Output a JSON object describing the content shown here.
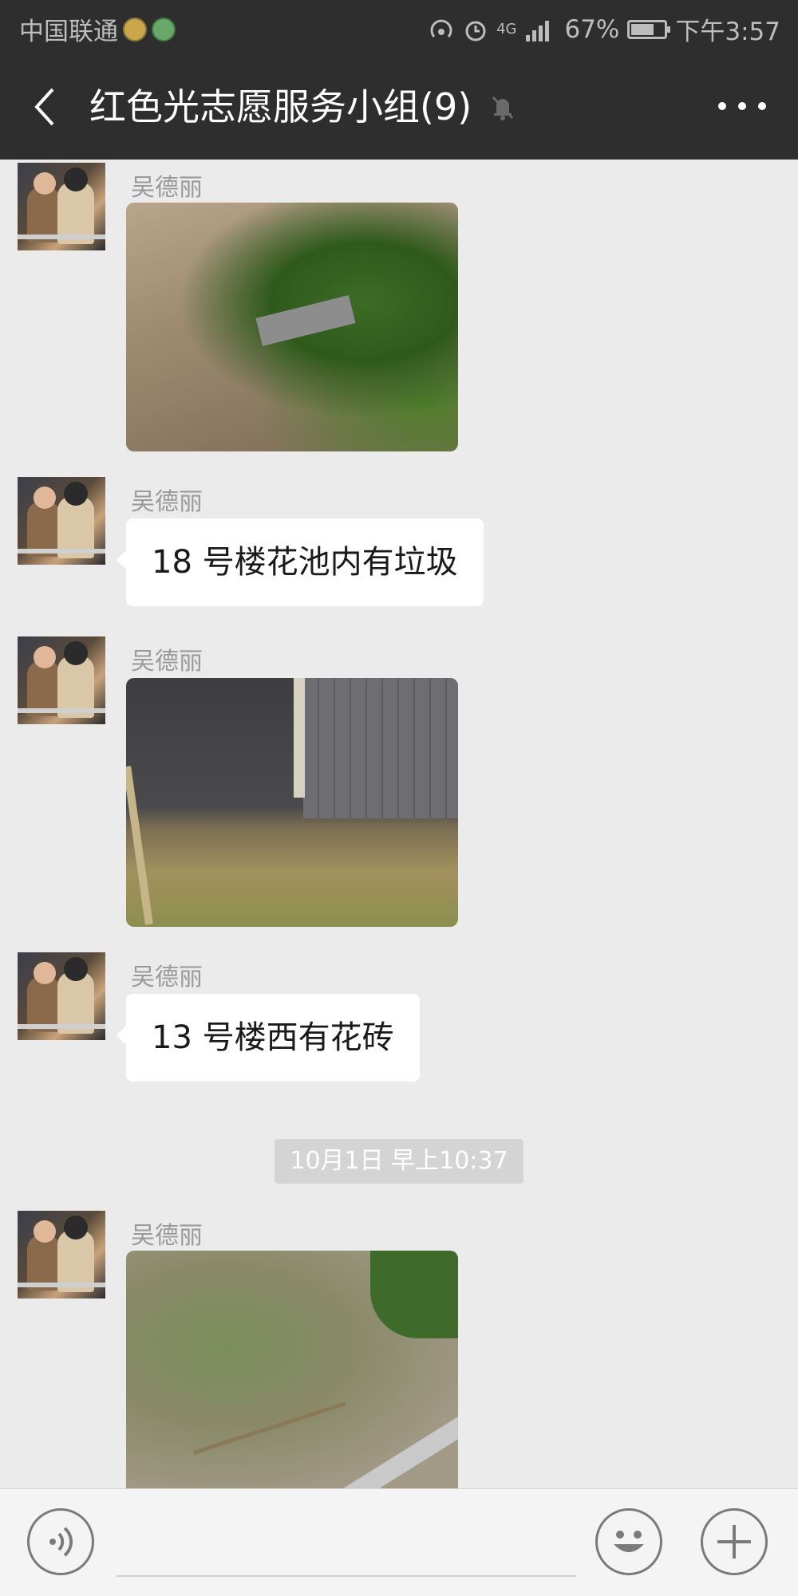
{
  "status_bar": {
    "carrier": "中国联通",
    "network": "4G",
    "battery": "67%",
    "time": "下午3:57"
  },
  "header": {
    "title": "红色光志愿服务小组(9)"
  },
  "messages": [
    {
      "type": "image",
      "sender": "吴德丽"
    },
    {
      "type": "text",
      "sender": "吴德丽",
      "text": "18 号楼花池内有垃圾"
    },
    {
      "type": "image",
      "sender": "吴德丽"
    },
    {
      "type": "text",
      "sender": "吴德丽",
      "text": "13 号楼西有花砖"
    },
    {
      "type": "image",
      "sender": "吴德丽"
    }
  ],
  "timestamp": "10月1日 早上10:37",
  "input_bar": {
    "icons": [
      "voice-icon",
      "emoji-icon",
      "plus-icon"
    ]
  }
}
